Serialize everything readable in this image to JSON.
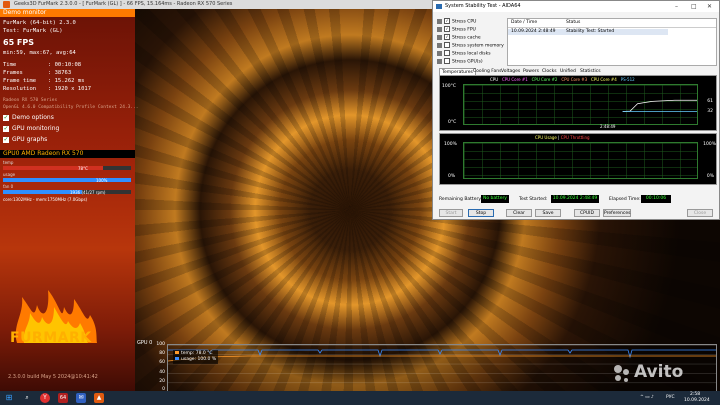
{
  "furmark_window": {
    "title": "Geeks3D FurMark 2.3.0.0 - [ FurMark (GL) ] - 66 FPS, 15.164ms - Radeon RX 570 Series"
  },
  "overlay": {
    "demo_monitor_label": "Demo monitor",
    "app_line": "FurMark (64-bit) 2.3.0",
    "test_line": "Test: FurMark (GL)",
    "fps": "65 FPS",
    "fps_stats": "min:59, max:67, avg:64",
    "time_label": "Time",
    "time_value": ": 00:10:08",
    "frames_label": "Frames",
    "frames_value": ": 38763",
    "frametime_label": "Frame time",
    "frametime_value": ": 15.262 ms",
    "resolution_label": "Resolution",
    "resolution_value": ": 1920 x 1017",
    "gpu_name_line": "Radeon RX 570 Series",
    "gl_line": "OpenGL 4.6.0 Compatibility Profile Context 24.3...",
    "options": [
      "Demo options",
      "GPU monitoring",
      "GPU graphs"
    ],
    "gpu_header": "GPU0  AMD Radeon RX 570",
    "meters": [
      {
        "label": "temp",
        "value": "78°C",
        "fill": 0.78
      },
      {
        "label": "usage",
        "value": "100%",
        "fill": 1.0
      },
      {
        "label": "fan 0",
        "value": "1936 (41/27 rpm)",
        "fill": 0.62
      }
    ],
    "clock_line": "core:1302MHz - mem:1750MHz (7.0Gbps)",
    "logo": "FURMARK",
    "version": "2.3.0.0 build May 5 2024@10:41:42"
  },
  "aida": {
    "title": "System Stability Test - AIDA64",
    "stress_items": [
      {
        "label": "Stress CPU",
        "checked": true
      },
      {
        "label": "Stress FPU",
        "checked": true
      },
      {
        "label": "Stress cache",
        "checked": true
      },
      {
        "label": "Stress system memory",
        "checked": false
      },
      {
        "label": "Stress local disks",
        "checked": false
      },
      {
        "label": "Stress GPU(s)",
        "checked": false
      }
    ],
    "log_headers": [
      "Date / Time",
      "Status"
    ],
    "log_row": {
      "datetime": "10.09.2024 2:48:49",
      "status": "Stability Test: Started"
    },
    "tabs": [
      "Temperatures",
      "Cooling Fans",
      "Voltages",
      "Powers",
      "Clocks",
      "Unified",
      "Statistics"
    ],
    "temp_graph": {
      "legend": [
        "CPU",
        "CPU Core #1",
        "CPU Core #2",
        "CPU Core #3",
        "CPU Core #4",
        "PS-512"
      ],
      "y_top": "100°C",
      "y_bottom": "0°C",
      "right_top": "61",
      "right_mid": "32",
      "time_label": "2:48:49",
      "series": [
        {
          "name": "CPU",
          "color": "#ffffff",
          "values": [
            32,
            33,
            52,
            55,
            58,
            59,
            60,
            61,
            61,
            61,
            61
          ]
        },
        {
          "name": "PS-512",
          "color": "#66ccff",
          "values": [
            32,
            32,
            32,
            32,
            32,
            32,
            32,
            32,
            32,
            32,
            32
          ]
        }
      ]
    },
    "usage_graph": {
      "legend_a": "CPU Usage",
      "legend_b": "CPU Throttling",
      "y_top": "100%",
      "y_bottom": "0%",
      "right_top": "100%",
      "right_bottom": "0%"
    },
    "battery_label": "Remaining Battery:",
    "battery_value": "No battery",
    "started_label": "Test Started:",
    "started_value": "10.09.2024 2:48:49",
    "elapsed_label": "Elapsed Time:",
    "elapsed_value": "00:10:06",
    "buttons": [
      "Start",
      "Stop",
      "Clear",
      "Save",
      "CPUID",
      "Preferences",
      "Close"
    ]
  },
  "gpu_graph": {
    "label": "GPU 0",
    "ticks": [
      "100",
      "80",
      "60",
      "40",
      "20",
      "0"
    ],
    "legend": [
      {
        "label": "temp: 78.0 °C",
        "color": "#ff9a2a"
      },
      {
        "label": "usage: 100.0 %",
        "color": "#3a8cff"
      }
    ]
  },
  "taskbar": {
    "badge": "64",
    "tray_lang": "РУС",
    "clock_time": "2:58",
    "clock_date": "10.09.2024"
  },
  "watermark": "Avito"
}
